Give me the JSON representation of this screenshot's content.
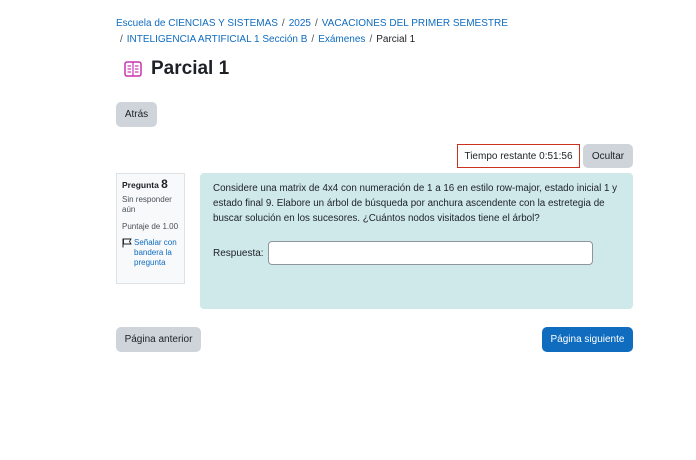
{
  "breadcrumb": {
    "items": [
      "Escuela de CIENCIAS Y SISTEMAS",
      "2025",
      "VACACIONES DEL PRIMER SEMESTRE",
      "INTELIGENCIA ARTIFICIAL 1 Sección B",
      "Exámenes"
    ],
    "current": "Parcial 1",
    "separator": "/"
  },
  "header": {
    "title": "Parcial 1",
    "icon": "quiz-icon"
  },
  "nav": {
    "back_label": "Atrás",
    "prev_label": "Página anterior",
    "next_label": "Página siguiente"
  },
  "timer": {
    "label": "Tiempo restante",
    "value": "0:51:56",
    "hide_label": "Ocultar"
  },
  "question": {
    "label": "Pregunta",
    "number": "8",
    "state": "Sin responder aún",
    "grade": "Puntaje de 1.00",
    "flag_label": "Señalar con bandera la pregunta",
    "text": "Considere una matrix de 4x4 con numeración de 1 a 16 en estilo row-major, estado inicial 1 y estado final 9. Elabore un árbol de búsqueda por anchura ascendente con la estretegia de buscar solución en los sucesores. ¿Cuántos nodos visitados tiene el árbol?",
    "answer_label": "Respuesta:",
    "answer_value": ""
  },
  "colors": {
    "primary": "#0f6cbf",
    "secondary_button": "#ced4da",
    "question_bg": "#cfe8ea",
    "timer_border": "#ca3120",
    "quiz_icon": "#c832b0"
  }
}
